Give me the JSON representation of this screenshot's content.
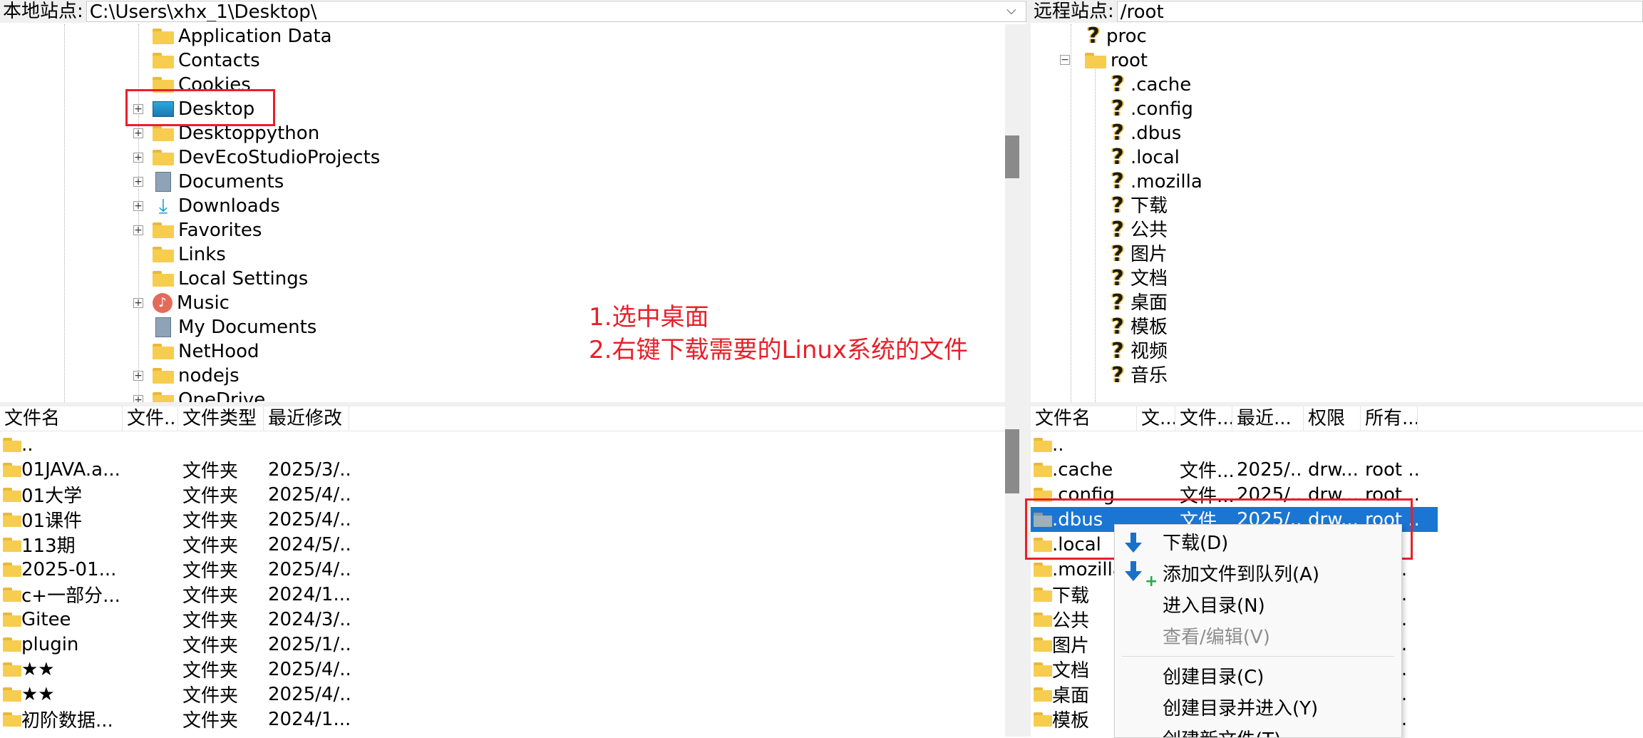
{
  "local": {
    "site_label": "本地站点:",
    "site_path": "C:\\Users\\xhx_1\\Desktop\\",
    "tree": [
      {
        "label": "Application Data",
        "icon": "folder-icon",
        "expander": false
      },
      {
        "label": "Contacts",
        "icon": "folder-icon",
        "expander": false
      },
      {
        "label": "Cookies",
        "icon": "folder-icon",
        "expander": false
      },
      {
        "label": "Desktop",
        "icon": "desktop-icon",
        "expander": true
      },
      {
        "label": "Desktoppython",
        "icon": "folder-icon",
        "expander": true
      },
      {
        "label": "DevEcoStudioProjects",
        "icon": "folder-icon",
        "expander": true
      },
      {
        "label": "Documents",
        "icon": "documents-icon",
        "expander": true
      },
      {
        "label": "Downloads",
        "icon": "download-icon",
        "expander": true
      },
      {
        "label": "Favorites",
        "icon": "folder-icon",
        "expander": true
      },
      {
        "label": "Links",
        "icon": "folder-icon",
        "expander": false
      },
      {
        "label": "Local Settings",
        "icon": "folder-icon",
        "expander": false
      },
      {
        "label": "Music",
        "icon": "music-icon",
        "expander": true
      },
      {
        "label": "My Documents",
        "icon": "documents-icon",
        "expander": false
      },
      {
        "label": "NetHood",
        "icon": "folder-icon",
        "expander": false
      },
      {
        "label": "nodejs",
        "icon": "folder-icon",
        "expander": true
      },
      {
        "label": "OneDrive",
        "icon": "folder-icon",
        "expander": true
      }
    ],
    "columns": [
      "文件名",
      "文件...",
      "文件类型",
      "最近修改"
    ],
    "files": [
      {
        "name": "..",
        "size": "",
        "type": "",
        "modified": ""
      },
      {
        "name": "01JAVA.a...",
        "size": "",
        "type": "文件夹",
        "modified": "2025/3/..."
      },
      {
        "name": "01大学",
        "size": "",
        "type": "文件夹",
        "modified": "2025/4/..."
      },
      {
        "name": "01课件",
        "size": "",
        "type": "文件夹",
        "modified": "2025/4/..."
      },
      {
        "name": "113期",
        "size": "",
        "type": "文件夹",
        "modified": "2024/5/..."
      },
      {
        "name": "2025-01...",
        "size": "",
        "type": "文件夹",
        "modified": "2025/4/..."
      },
      {
        "name": "c+一部分...",
        "size": "",
        "type": "文件夹",
        "modified": "2024/1..."
      },
      {
        "name": "Gitee",
        "size": "",
        "type": "文件夹",
        "modified": "2024/3/..."
      },
      {
        "name": "plugin",
        "size": "",
        "type": "文件夹",
        "modified": "2025/1/..."
      },
      {
        "name": "★★",
        "size": "",
        "type": "文件夹",
        "modified": "2025/4/..."
      },
      {
        "name": "★★",
        "size": "",
        "type": "文件夹",
        "modified": "2025/4/..."
      },
      {
        "name": "初阶数据...",
        "size": "",
        "type": "文件夹",
        "modified": "2024/1..."
      }
    ]
  },
  "remote": {
    "site_label": "远程站点:",
    "site_path": "/root",
    "tree": [
      {
        "label": "proc",
        "icon": "question-icon",
        "level": 1
      },
      {
        "label": "root",
        "icon": "folder-icon",
        "level": 1,
        "expanded": true
      },
      {
        "label": ".cache",
        "icon": "question-icon",
        "level": 2
      },
      {
        "label": ".config",
        "icon": "question-icon",
        "level": 2
      },
      {
        "label": ".dbus",
        "icon": "question-icon",
        "level": 2
      },
      {
        "label": ".local",
        "icon": "question-icon",
        "level": 2
      },
      {
        "label": ".mozilla",
        "icon": "question-icon",
        "level": 2
      },
      {
        "label": "下载",
        "icon": "question-icon",
        "level": 2
      },
      {
        "label": "公共",
        "icon": "question-icon",
        "level": 2
      },
      {
        "label": "图片",
        "icon": "question-icon",
        "level": 2
      },
      {
        "label": "文档",
        "icon": "question-icon",
        "level": 2
      },
      {
        "label": "桌面",
        "icon": "question-icon",
        "level": 2
      },
      {
        "label": "模板",
        "icon": "question-icon",
        "level": 2
      },
      {
        "label": "视频",
        "icon": "question-icon",
        "level": 2
      },
      {
        "label": "音乐",
        "icon": "question-icon",
        "level": 2
      }
    ],
    "columns": [
      "文件名",
      "文...",
      "文件...",
      "最近...",
      "权限",
      "所有..."
    ],
    "files": [
      {
        "name": "..",
        "size": "",
        "type": "",
        "modified": "",
        "perm": "",
        "owner": "",
        "selected": false
      },
      {
        "name": ".cache",
        "size": "",
        "type": "文件...",
        "modified": "2025/...",
        "perm": "drw...",
        "owner": "root ...",
        "selected": false
      },
      {
        "name": ".config",
        "size": "",
        "type": "文件...",
        "modified": "2025/...",
        "perm": "drw...",
        "owner": "root ...",
        "selected": false
      },
      {
        "name": ".dbus",
        "size": "",
        "type": "文件...",
        "modified": "2025/...",
        "perm": "drw...",
        "owner": "root ...",
        "selected": true
      },
      {
        "name": ".local",
        "size": "",
        "type": "",
        "modified": "",
        "perm": "",
        "owner": "",
        "selected": false
      },
      {
        "name": ".mozilla",
        "size": "",
        "type": "",
        "modified": "",
        "perm": "",
        "owner": "ot ...",
        "selected": false
      },
      {
        "name": "下载",
        "size": "",
        "type": "",
        "modified": "",
        "perm": "",
        "owner": "ot ...",
        "selected": false
      },
      {
        "name": "公共",
        "size": "",
        "type": "",
        "modified": "",
        "perm": "",
        "owner": "ot ...",
        "selected": false
      },
      {
        "name": "图片",
        "size": "",
        "type": "",
        "modified": "",
        "perm": "",
        "owner": "ot ...",
        "selected": false
      },
      {
        "name": "文档",
        "size": "",
        "type": "",
        "modified": "",
        "perm": "",
        "owner": "ot ...",
        "selected": false
      },
      {
        "name": "桌面",
        "size": "",
        "type": "",
        "modified": "",
        "perm": "",
        "owner": "ot ...",
        "selected": false
      },
      {
        "name": "模板",
        "size": "",
        "type": "",
        "modified": "",
        "perm": "",
        "owner": "ot ...",
        "selected": false
      }
    ]
  },
  "context_menu": {
    "items": [
      {
        "label": "下载(D)",
        "icon": "download-arrow-icon",
        "disabled": false
      },
      {
        "label": "添加文件到队列(A)",
        "icon": "add-to-queue-icon",
        "disabled": false
      },
      {
        "label": "进入目录(N)",
        "icon": "",
        "disabled": false
      },
      {
        "label": "查看/编辑(V)",
        "icon": "",
        "disabled": true
      },
      {
        "label": "创建目录(C)",
        "icon": "",
        "disabled": false
      },
      {
        "label": "创建目录并进入(Y)",
        "icon": "",
        "disabled": false
      },
      {
        "label": "创建新文件(T)",
        "icon": "",
        "disabled": false
      }
    ]
  },
  "annotation": {
    "line1": "1.选中桌面",
    "line2": "2.右键下载需要的Linux系统的文件",
    "color": "#e8202a"
  },
  "colors": {
    "selection": "#1a76d2",
    "folder": "#f7cd4f",
    "highlight_box": "#e8202a"
  }
}
